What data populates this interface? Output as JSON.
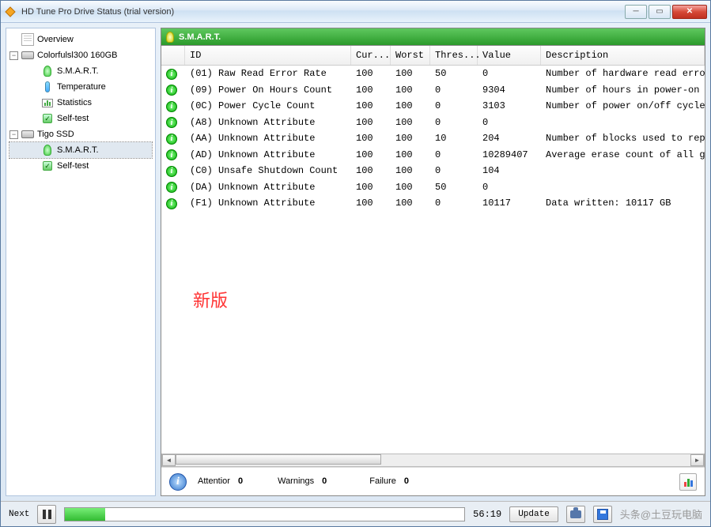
{
  "window": {
    "title": "HD Tune Pro Drive Status (trial version)"
  },
  "tree": {
    "overview": "Overview",
    "drive1": {
      "name": "Colorfulsl300 160GB",
      "smart": "S.M.A.R.T.",
      "temp": "Temperature",
      "stats": "Statistics",
      "selftest": "Self-test"
    },
    "drive2": {
      "name": "Tigo    SSD",
      "smart": "S.M.A.R.T.",
      "selftest": "Self-test"
    }
  },
  "panel": {
    "title": "S.M.A.R.T."
  },
  "headers": {
    "id": "ID",
    "cur": "Cur...",
    "worst": "Worst",
    "thres": "Thres...",
    "value": "Value",
    "desc": "Description"
  },
  "rows": [
    {
      "id": "(01) Raw Read Error Rate",
      "cur": "100",
      "worst": "100",
      "thres": "50",
      "value": "0",
      "desc": "Number of hardware read erro"
    },
    {
      "id": "(09) Power On Hours Count",
      "cur": "100",
      "worst": "100",
      "thres": "0",
      "value": "9304",
      "desc": "Number of hours in power-on"
    },
    {
      "id": "(0C) Power Cycle Count",
      "cur": "100",
      "worst": "100",
      "thres": "0",
      "value": "3103",
      "desc": "Number of power on/off cycle"
    },
    {
      "id": "(A8) Unknown Attribute",
      "cur": "100",
      "worst": "100",
      "thres": "0",
      "value": "0",
      "desc": ""
    },
    {
      "id": "(AA) Unknown Attribute",
      "cur": "100",
      "worst": "100",
      "thres": "10",
      "value": "204",
      "desc": "Number of blocks used to rep"
    },
    {
      "id": "(AD) Unknown Attribute",
      "cur": "100",
      "worst": "100",
      "thres": "0",
      "value": "10289407",
      "desc": "Average erase count of all g"
    },
    {
      "id": "(C0) Unsafe Shutdown Count",
      "cur": "100",
      "worst": "100",
      "thres": "0",
      "value": "104",
      "desc": ""
    },
    {
      "id": "(DA) Unknown Attribute",
      "cur": "100",
      "worst": "100",
      "thres": "50",
      "value": "0",
      "desc": ""
    },
    {
      "id": "(F1) Unknown Attribute",
      "cur": "100",
      "worst": "100",
      "thres": "0",
      "value": "10117",
      "desc": "Data written: 10117 GB"
    }
  ],
  "watermark": "新版",
  "summary": {
    "attention_l": "Attentior",
    "attention_v": "0",
    "warnings_l": "Warnings",
    "warnings_v": "0",
    "failure_l": "Failure",
    "failure_v": "0"
  },
  "footer": {
    "next": "Next",
    "time": "56:19",
    "update": "Update",
    "credit": "头条@土豆玩电脑"
  }
}
